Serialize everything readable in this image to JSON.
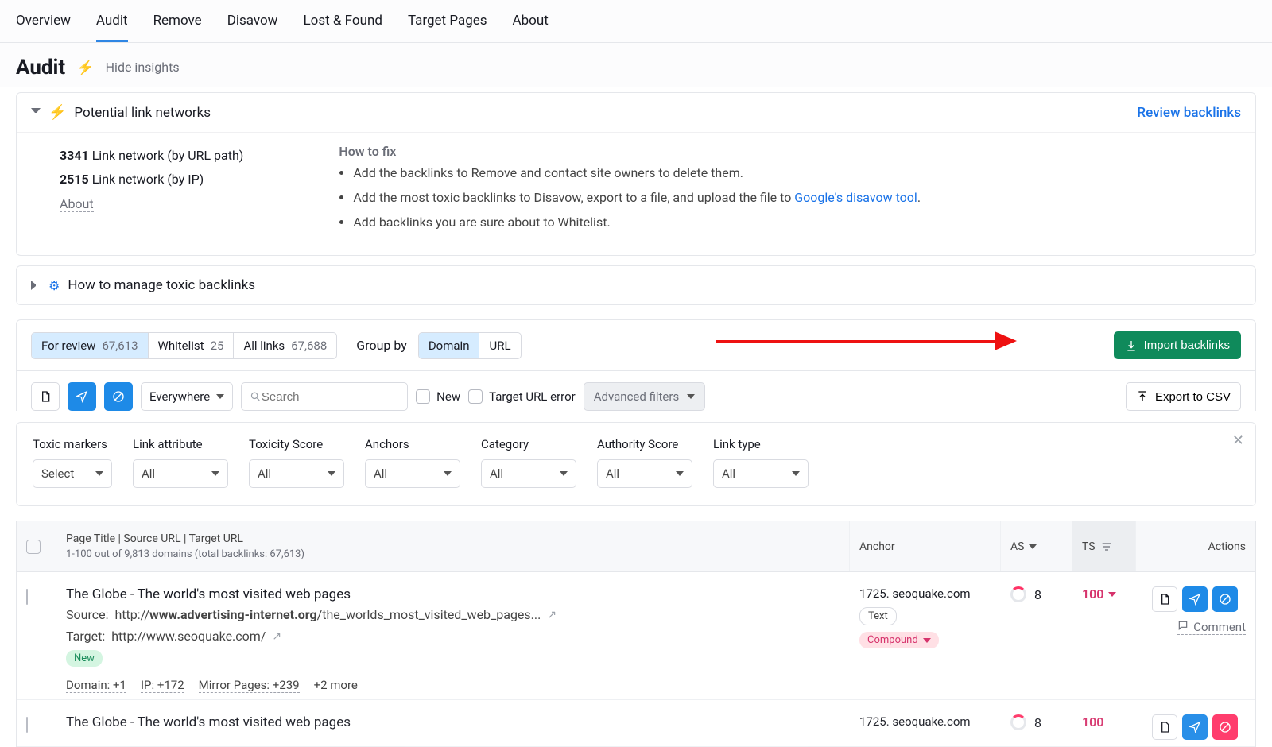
{
  "nav": {
    "items": [
      "Overview",
      "Audit",
      "Remove",
      "Disavow",
      "Lost & Found",
      "Target Pages",
      "About"
    ],
    "active": "Audit"
  },
  "header": {
    "title": "Audit",
    "hide_insights": "Hide insights"
  },
  "panel_networks": {
    "title": "Potential link networks",
    "review": "Review backlinks",
    "m1_val": "3341",
    "m1_lbl": "Link network (by URL path)",
    "m2_val": "2515",
    "m2_lbl": "Link network (by IP)",
    "about": "About",
    "howto_h": "How to fix",
    "fix1": "Add the backlinks to Remove and contact site owners to delete them.",
    "fix2a": "Add the most toxic backlinks to Disavow, export to a file, and upload the file to ",
    "fix2_link": "Google's disavow tool",
    "fix2b": ".",
    "fix3": "Add backlinks you are sure about to Whitelist."
  },
  "panel_manage": {
    "title": "How to manage toxic backlinks"
  },
  "tabs": {
    "for_review": "For review",
    "for_review_n": "67,613",
    "whitelist": "Whitelist",
    "whitelist_n": "25",
    "all": "All links",
    "all_n": "67,688",
    "groupby": "Group by",
    "domain": "Domain",
    "url": "URL",
    "import": "Import backlinks"
  },
  "toolbar": {
    "everywhere": "Everywhere",
    "search_ph": "Search",
    "new": "New",
    "target_err": "Target URL error",
    "adv": "Advanced filters",
    "export": "Export to CSV"
  },
  "filters": {
    "labels": [
      "Toxic markers",
      "Link attribute",
      "Toxicity Score",
      "Anchors",
      "Category",
      "Authority Score",
      "Link type"
    ],
    "select": "Select",
    "all": "All"
  },
  "thead": {
    "col1a": "Page Title | Source URL | Target URL",
    "col1b": "1-100 out of 9,813 domains (total backlinks: 67,613)",
    "anchor": "Anchor",
    "as": "AS",
    "ts": "TS",
    "actions": "Actions"
  },
  "rows": [
    {
      "title": "The Globe - The world's most visited web pages",
      "src_lbl": "Source:",
      "src_pre": "http://",
      "src_bold": "www.advertising-internet.org",
      "src_post": "/the_worlds_most_visited_web_pages...",
      "tgt_lbl": "Target:",
      "tgt": "http://www.seoquake.com/",
      "new": "New",
      "meta": [
        "Domain: +1",
        "IP: +172",
        "Mirror Pages: +239",
        "+2 more"
      ],
      "anchor": "1725. seoquake.com",
      "anchor_tag": "Text",
      "anchor_compound": "Compound",
      "as": "8",
      "ts": "100",
      "comment": "Comment"
    },
    {
      "title": "The Globe - The world's most visited web pages",
      "anchor": "1725. seoquake.com",
      "as": "8",
      "ts": "100"
    }
  ]
}
